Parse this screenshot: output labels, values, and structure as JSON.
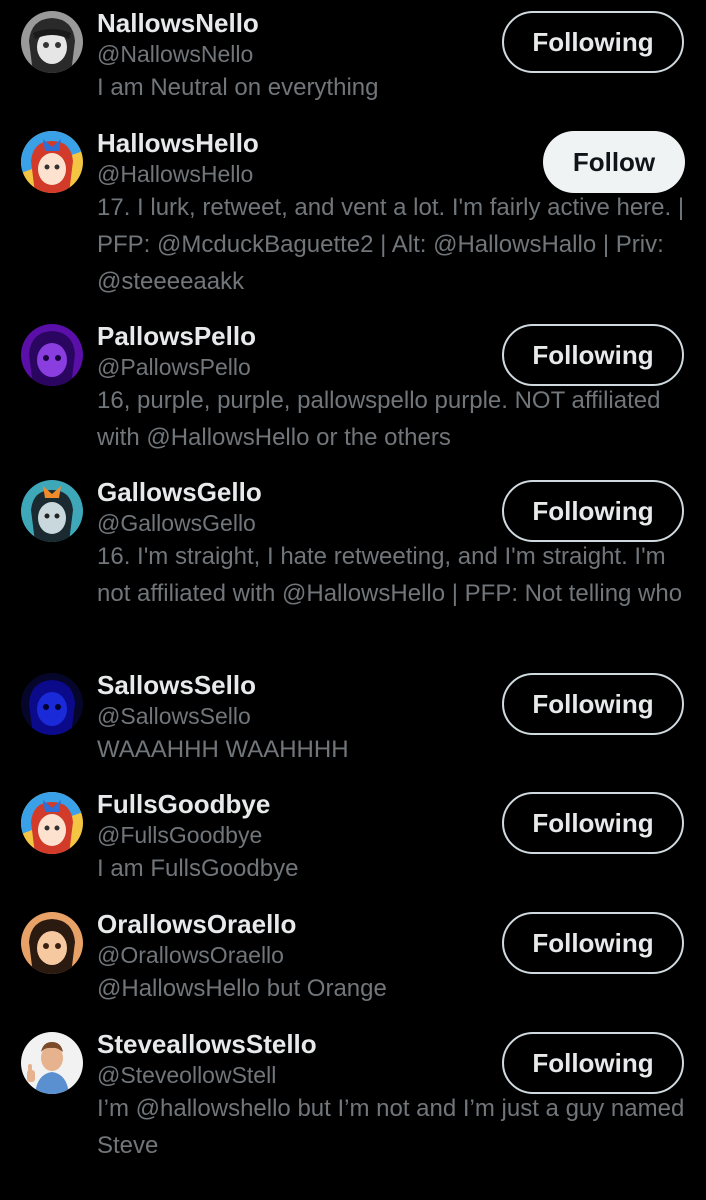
{
  "users": [
    {
      "name": "NallowsNello",
      "handle": "@NallowsNello",
      "bio": "I am Neutral on everything",
      "button": "Following"
    },
    {
      "name": "HallowsHello",
      "handle": "@HallowsHello",
      "bio": "17. I lurk, retweet, and vent a lot. I'm fairly active here. | PFP: @McduckBaguette2 | Alt: @HallowsHallo | Priv: @steeeeaakk",
      "button": "Follow"
    },
    {
      "name": "PallowsPello",
      "handle": "@PallowsPello",
      "bio": "16, purple, purple, pallowspello purple. NOT affiliated with @HallowsHello or the others",
      "button": "Following"
    },
    {
      "name": "GallowsGello",
      "handle": "@GallowsGello",
      "bio": "16. I'm straight, I hate retweeting, and I'm straight. I'm not affiliated with @HallowsHello | PFP: Not telling who",
      "button": "Following"
    },
    {
      "name": "SallowsSello",
      "handle": "@SallowsSello",
      "bio": "WAAAHHH WAAHHHH",
      "button": "Following"
    },
    {
      "name": "FullsGoodbye",
      "handle": "@FullsGoodbye",
      "bio": "I am FullsGoodbye",
      "button": "Following"
    },
    {
      "name": "OrallowsOraello",
      "handle": "@OrallowsOraello",
      "bio": "@HallowsHello but Orange",
      "button": "Following"
    },
    {
      "name": "SteveallowsStello",
      "handle": "@SteveollowStell",
      "bio": "I’m @hallowshello but I’m not and I’m just a guy named Steve",
      "button": "Following"
    }
  ],
  "colors": {
    "background": "#000000",
    "name": "#e7e9ea",
    "secondary": "#71767b",
    "follow_button_bg": "#eff3f4",
    "following_border": "#cfd9de"
  }
}
